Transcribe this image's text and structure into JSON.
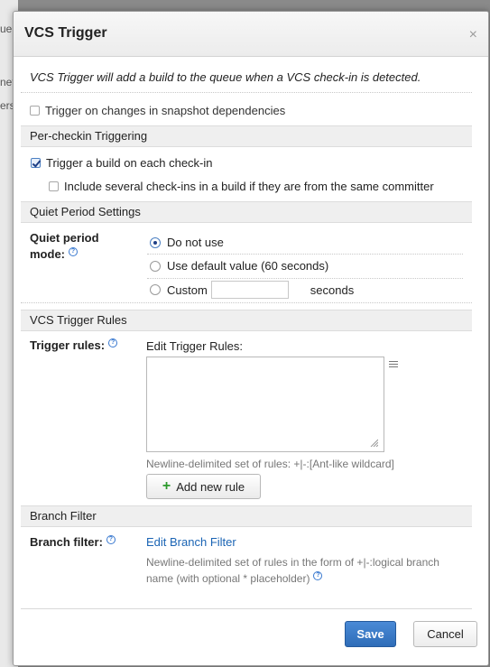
{
  "background": {
    "fragments": [
      "ueu",
      "net",
      "ers"
    ]
  },
  "dialog": {
    "title": "VCS Trigger",
    "close_glyph": "×",
    "description": "VCS Trigger will add a build to the queue when a VCS check-in is detected.",
    "snapshot_option": {
      "label": "Trigger on changes in snapshot dependencies",
      "checked": false
    },
    "per_checkin": {
      "header": "Per-checkin Triggering",
      "trigger_each": {
        "label": "Trigger a build on each check-in",
        "checked": true
      },
      "include_several": {
        "label": "Include several check-ins in a build if they are from the same committer",
        "checked": false
      }
    },
    "quiet_period": {
      "header": "Quiet Period Settings",
      "label_line1": "Quiet period",
      "label_line2": "mode:",
      "options": [
        {
          "label": "Do not use",
          "selected": true
        },
        {
          "label": "Use default value (60 seconds)",
          "selected": false
        },
        {
          "label": "Custom",
          "selected": false
        }
      ],
      "custom_value": "",
      "seconds_label": "seconds"
    },
    "rules": {
      "header": "VCS Trigger Rules",
      "label": "Trigger rules:",
      "edit_label": "Edit Trigger Rules:",
      "textarea_value": "",
      "hint": "Newline-delimited set of rules: +|-:[Ant-like wildcard]",
      "add_button": "Add new rule"
    },
    "branch": {
      "header": "Branch Filter",
      "label": "Branch filter:",
      "edit_link": "Edit Branch Filter",
      "hint_line1": "Newline-delimited set of rules in the form of +|-:logical branch",
      "hint_line2": "name (with optional * placeholder)"
    },
    "buttons": {
      "save": "Save",
      "cancel": "Cancel"
    },
    "colors": {
      "accent": "#2f6db8",
      "link": "#1a64b4",
      "section_bg": "#efefef"
    }
  }
}
